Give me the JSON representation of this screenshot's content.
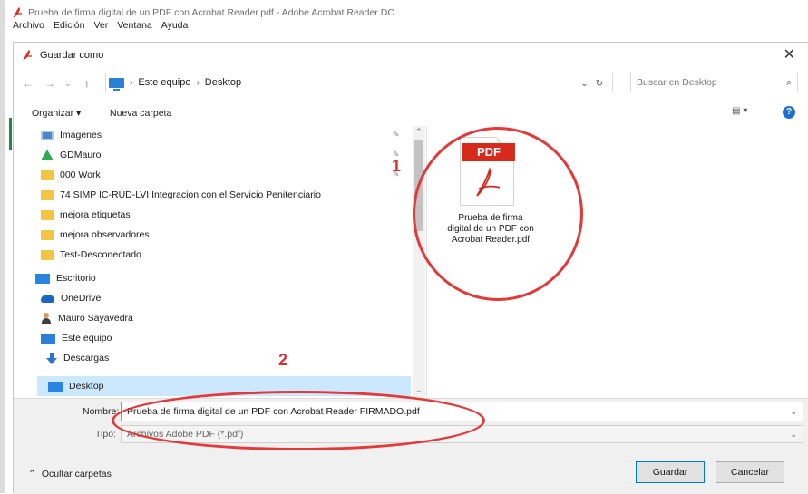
{
  "app": {
    "title": "Prueba de firma digital de un PDF con Acrobat Reader.pdf - Adobe Acrobat Reader DC",
    "menu": [
      "Archivo",
      "Edición",
      "Ver",
      "Ventana",
      "Ayuda"
    ]
  },
  "dialog": {
    "title": "Guardar como",
    "close": "✕",
    "breadcrumb": [
      "Este equipo",
      "Desktop"
    ],
    "search_placeholder": "Buscar en Desktop",
    "toolbar": {
      "organize": "Organizar ▾",
      "new_folder": "Nueva carpeta",
      "view": "▤ ▾",
      "help": "?"
    },
    "nav_items": [
      {
        "label": "Imágenes",
        "icon": "pictures-icon",
        "pinned": true
      },
      {
        "label": "GDMauro",
        "icon": "google-drive-icon",
        "pinned": true
      },
      {
        "label": "000 Work",
        "icon": "folder-icon",
        "pinned": true
      },
      {
        "label": "74 SIMP IC-RUD-LVI Integracion con el Servicio Penitenciario",
        "icon": "folder-icon",
        "pinned": false
      },
      {
        "label": "mejora etiquetas",
        "icon": "folder-icon",
        "pinned": false
      },
      {
        "label": "mejora observadores",
        "icon": "folder-icon",
        "pinned": false
      },
      {
        "label": "Test-Desconectado",
        "icon": "folder-icon",
        "pinned": false
      },
      {
        "label": "Escritorio",
        "icon": "desktop-icon",
        "pinned": false
      },
      {
        "label": "OneDrive",
        "icon": "onedrive-icon",
        "pinned": false
      },
      {
        "label": "Mauro Sayavedra",
        "icon": "user-icon",
        "pinned": false
      },
      {
        "label": "Este equipo",
        "icon": "computer-icon",
        "pinned": false
      },
      {
        "label": "Descargas",
        "icon": "downloads-icon",
        "pinned": false
      },
      {
        "label": "Desktop",
        "icon": "desktop-icon",
        "pinned": false,
        "selected": true
      }
    ],
    "file": {
      "badge": "PDF",
      "name": "Prueba de firma digital de un PDF con Acrobat Reader.pdf"
    },
    "filename_label": "Nombre:",
    "filename_value": "Prueba de firma digital de un PDF con Acrobat Reader FIRMADO.pdf",
    "filetype_label": "Tipo:",
    "filetype_value": "Archivos Adobe PDF (*.pdf)",
    "hide_folders": "Ocultar carpetas",
    "save_button": "Guardar",
    "cancel_button": "Cancelar"
  },
  "annotations": {
    "marker1": "1",
    "marker2": "2",
    "color": "#e23a3a"
  }
}
